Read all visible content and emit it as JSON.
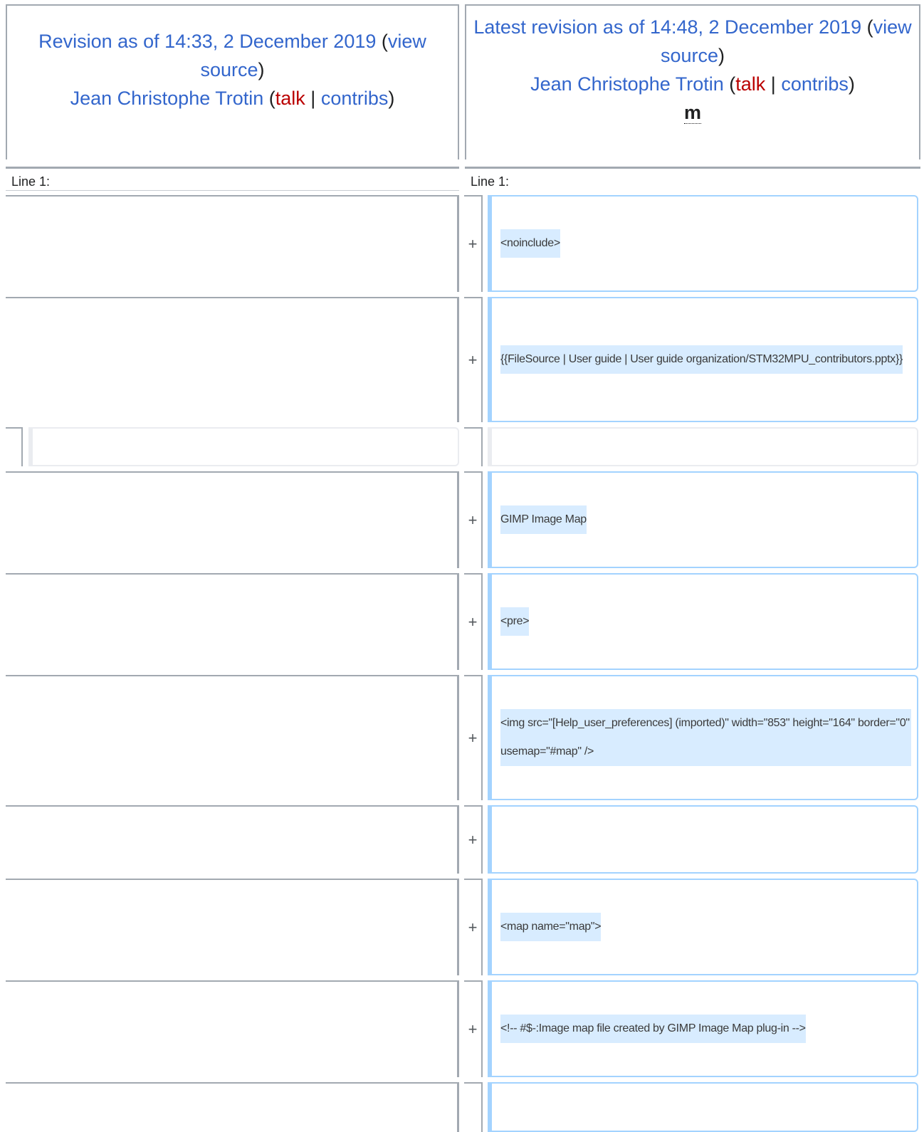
{
  "header": {
    "left": {
      "revision_link": "Revision as of 14:33, 2 December 2019",
      "open_paren": "(",
      "view_source": "view source",
      "close_paren": ")",
      "author": "Jean Christophe Trotin",
      "author_open": " (",
      "talk": "talk",
      "sep": " | ",
      "contribs": "contribs",
      "author_close": ")"
    },
    "right": {
      "revision_link": "Latest revision as of 14:48, 2 December 2019",
      "open_paren": " (",
      "view_source": "view source",
      "close_paren": ")",
      "author": "Jean Christophe Trotin",
      "author_open": " (",
      "talk": "talk",
      "sep": " | ",
      "contribs": "contribs",
      "author_close": ")",
      "minor_flag": "m"
    }
  },
  "line_numbers": {
    "left": "Line 1:",
    "right": "Line 1:"
  },
  "marker": "+",
  "added_lines": [
    "<noinclude>",
    "{{FileSource | User guide | User guide organization/STM32MPU_contributors.pptx}}",
    "GIMP Image Map",
    "<pre>",
    "<img src=\"[Help_user_preferences] (imported)\" width=\"853\" height=\"164\" border=\"0\" usemap=\"#map\" />",
    "",
    "<map name=\"map\">",
    "<!-- #$-:Image map file created by GIMP Image Map plug-in -->"
  ]
}
